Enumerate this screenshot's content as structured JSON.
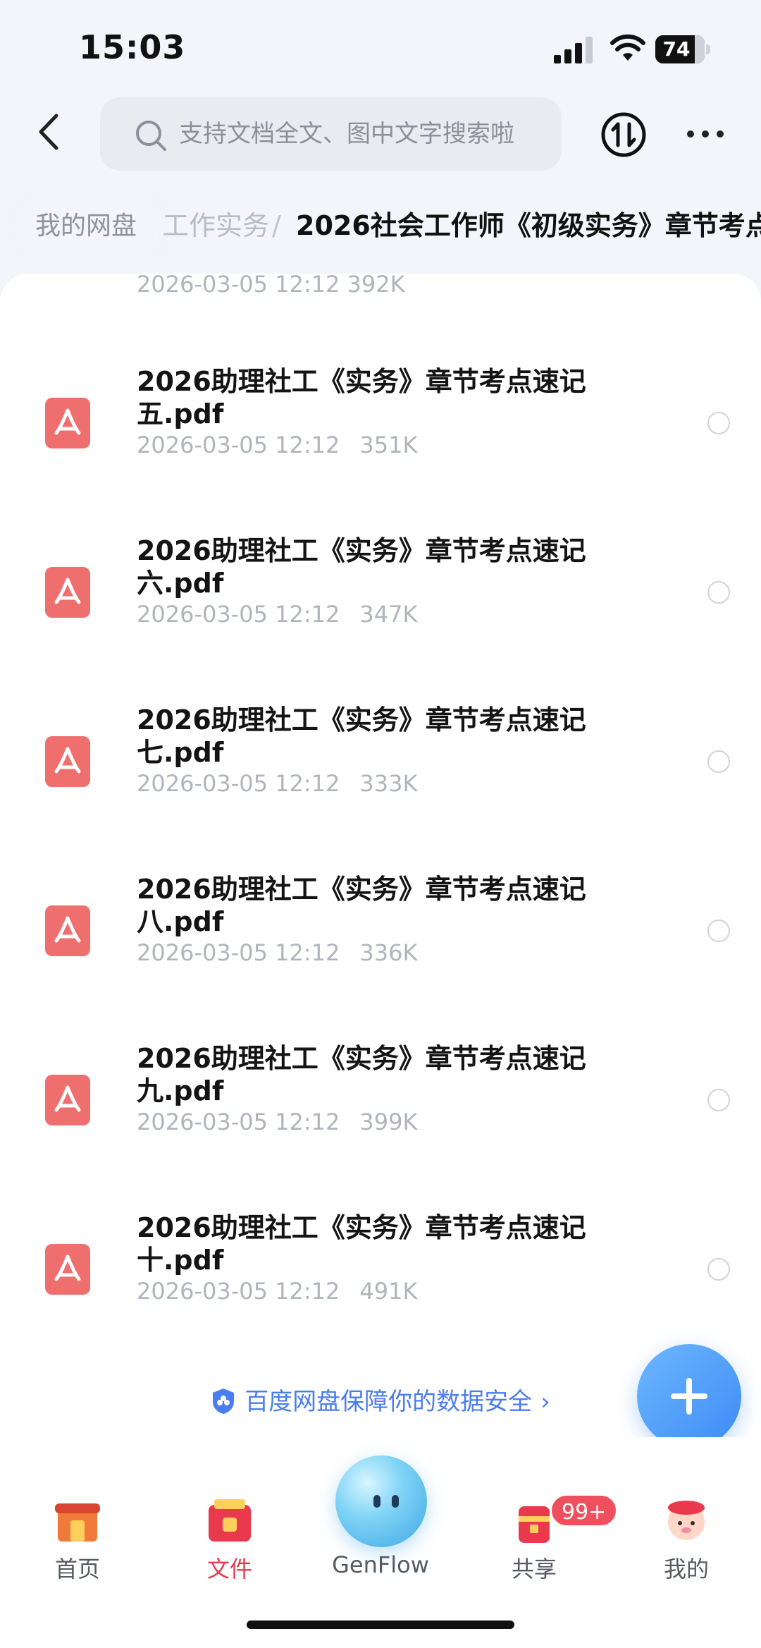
{
  "status_bar": {
    "time": "15:03",
    "battery": "74",
    "battery_level": 0.74
  },
  "header": {
    "search_placeholder": "支持文档全文、图中文字搜索啦"
  },
  "breadcrumb": {
    "root": "我的网盘",
    "hidden_segment": "工作实务",
    "separator": "/",
    "current": "2026社会工作师《初级实务》章节考点"
  },
  "partial_row_meta": "2026-03-05 12:12   392K",
  "files": [
    {
      "name": "2026助理社工《实务》章节考点速记五.pdf",
      "date": "2026-03-05 12:12",
      "size": "351K"
    },
    {
      "name": "2026助理社工《实务》章节考点速记六.pdf",
      "date": "2026-03-05 12:12",
      "size": "347K"
    },
    {
      "name": "2026助理社工《实务》章节考点速记七.pdf",
      "date": "2026-03-05 12:12",
      "size": "333K"
    },
    {
      "name": "2026助理社工《实务》章节考点速记八.pdf",
      "date": "2026-03-05 12:12",
      "size": "336K"
    },
    {
      "name": "2026助理社工《实务》章节考点速记九.pdf",
      "date": "2026-03-05 12:12",
      "size": "399K"
    },
    {
      "name": "2026助理社工《实务》章节考点速记十.pdf",
      "date": "2026-03-05 12:12",
      "size": "491K"
    }
  ],
  "security_note": "百度网盘保障你的数据安全",
  "tabs": {
    "home": "首页",
    "files": "文件",
    "genflow": "GenFlow",
    "share": "共享",
    "me": "我的",
    "share_badge": "99+"
  },
  "colors": {
    "accent_blue": "#3d8bf5",
    "active_red": "#e8394d",
    "pdf_red": "#ef6e6e"
  }
}
